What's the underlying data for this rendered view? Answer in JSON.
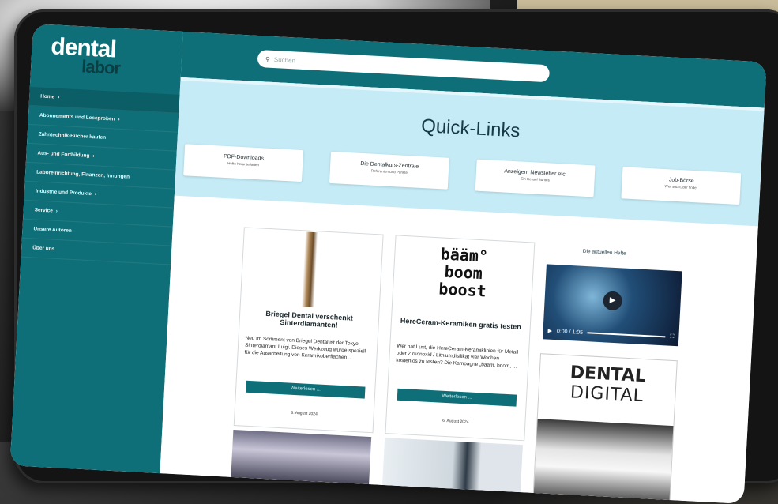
{
  "site": {
    "logo_top": "dental",
    "logo_bottom": "labor"
  },
  "search": {
    "placeholder": "Suchen"
  },
  "sidebar": {
    "items": [
      {
        "label": "Home",
        "chevron": true
      },
      {
        "label": "Abonnements und Leseproben",
        "chevron": true
      },
      {
        "label": "Zahntechnik-Bücher kaufen",
        "chevron": false
      },
      {
        "label": "Aus- und Fortbildung",
        "chevron": true
      },
      {
        "label": "Laboreinrichtung, Finanzen, Innungen",
        "chevron": false
      },
      {
        "label": "Industrie und Produkte",
        "chevron": true
      },
      {
        "label": "Service",
        "chevron": true
      },
      {
        "label": "Unsere Autoren",
        "chevron": false
      },
      {
        "label": "Über uns",
        "chevron": false
      }
    ]
  },
  "banner": {
    "title": "Quick-Links",
    "links": [
      {
        "title": "PDF-Downloads",
        "subtitle": "Hefte herunterladen"
      },
      {
        "title": "Die Dentalkurs-Zentrale",
        "subtitle": "Referenten und Punkte"
      },
      {
        "title": "Anzeigen, Newsletter etc.",
        "subtitle": "Ein Kessel Buntes"
      },
      {
        "title": "Job-Börse",
        "subtitle": "Wer sucht, der findet"
      }
    ]
  },
  "articles": [
    {
      "title": "Briegel Dental verschenkt Sinterdiamanten!",
      "excerpt": "Neu im Sortiment von Briegel Dental ist der Tokyo Sinterdiamant Luigi. Dieses Werkzeug wurde speziell für die Ausarbeitung von Keramikoberflächen ...",
      "button": "Weiterlesen ...",
      "date": "6. August 2024"
    },
    {
      "image_text": [
        "bääm°",
        "boom",
        "boost"
      ],
      "title": "HereCeram-Keramiken gratis testen",
      "excerpt": "Wer hat Lust, die HereCeram-Keramiklinien für Metall oder Zirkonoxid / Lithiumdisilikat vier Wochen kostenlos zu testen? Die Kampagne „bääm, boom, ...",
      "button": "Weiterlesen ...",
      "date": "6. August 2024"
    }
  ],
  "aside": {
    "title": "Die aktuellen Hefte",
    "video_time": "0:00 / 1:05",
    "magazine_line1": "DENTAL",
    "magazine_line2": "DIGITAL"
  },
  "colors": {
    "teal": "#0f6f78",
    "banner": "#c4ebf6"
  }
}
